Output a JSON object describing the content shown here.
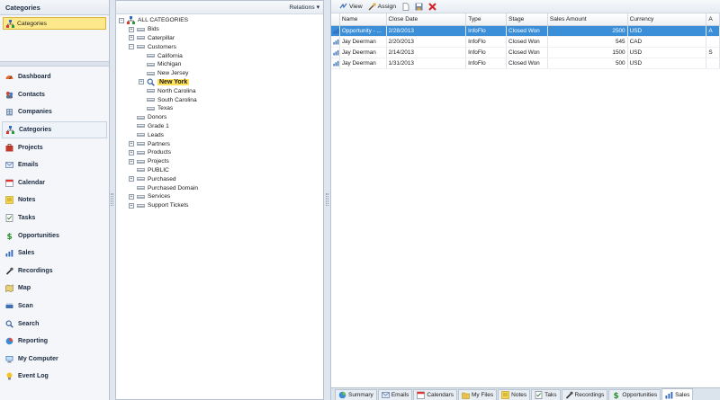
{
  "left": {
    "title": "Categories",
    "selected_category": "Categories"
  },
  "nav": [
    {
      "label": "Dashboard",
      "icon": "dashboard-icon"
    },
    {
      "label": "Contacts",
      "icon": "contacts-icon"
    },
    {
      "label": "Companies",
      "icon": "companies-icon"
    },
    {
      "label": "Categories",
      "icon": "categories-icon"
    },
    {
      "label": "Projects",
      "icon": "projects-icon"
    },
    {
      "label": "Emails",
      "icon": "emails-icon"
    },
    {
      "label": "Calendar",
      "icon": "calendar-icon"
    },
    {
      "label": "Notes",
      "icon": "notes-icon"
    },
    {
      "label": "Tasks",
      "icon": "tasks-icon"
    },
    {
      "label": "Opportunities",
      "icon": "opportunities-icon"
    },
    {
      "label": "Sales",
      "icon": "sales-icon"
    },
    {
      "label": "Recordings",
      "icon": "recordings-icon"
    },
    {
      "label": "Map",
      "icon": "map-icon"
    },
    {
      "label": "Scan",
      "icon": "scan-icon"
    },
    {
      "label": "Search",
      "icon": "search-icon"
    },
    {
      "label": "Reporting",
      "icon": "reporting-icon"
    },
    {
      "label": "My Computer",
      "icon": "my-computer-icon"
    },
    {
      "label": "Event Log",
      "icon": "event-log-icon"
    }
  ],
  "tree_panel": {
    "relations_label": "Relations ▾",
    "nodes": [
      {
        "label": "ALL CATEGORIES",
        "level": 0,
        "expander": "−",
        "root": true
      },
      {
        "label": "Bids",
        "level": 1,
        "expander": "+"
      },
      {
        "label": "Caterpillar",
        "level": 1,
        "expander": "+"
      },
      {
        "label": "Customers",
        "level": 1,
        "expander": "−"
      },
      {
        "label": "California",
        "level": 2,
        "expander": ""
      },
      {
        "label": "Michigan",
        "level": 2,
        "expander": ""
      },
      {
        "label": "New Jersey",
        "level": 2,
        "expander": ""
      },
      {
        "label": "New York",
        "level": 2,
        "expander": "+",
        "selected": true
      },
      {
        "label": "North Carolina",
        "level": 2,
        "expander": ""
      },
      {
        "label": "South Carolina",
        "level": 2,
        "expander": ""
      },
      {
        "label": "Texas",
        "level": 2,
        "expander": ""
      },
      {
        "label": "Donors",
        "level": 1,
        "expander": ""
      },
      {
        "label": "Grade 1",
        "level": 1,
        "expander": ""
      },
      {
        "label": "Leads",
        "level": 1,
        "expander": ""
      },
      {
        "label": "Partners",
        "level": 1,
        "expander": "+"
      },
      {
        "label": "Products",
        "level": 1,
        "expander": "+"
      },
      {
        "label": "Projects",
        "level": 1,
        "expander": "+"
      },
      {
        "label": "PUBLIC",
        "level": 1,
        "expander": ""
      },
      {
        "label": "Purchased",
        "level": 1,
        "expander": "+"
      },
      {
        "label": "Purchased Domain",
        "level": 1,
        "expander": ""
      },
      {
        "label": "Services",
        "level": 1,
        "expander": "+"
      },
      {
        "label": "Support Tickets",
        "level": 1,
        "expander": "+"
      }
    ]
  },
  "toolbar": {
    "view_label": "View",
    "assign_label": "Assign"
  },
  "grid": {
    "columns": [
      {
        "label": "",
        "w": 10
      },
      {
        "label": "Name",
        "w": 53
      },
      {
        "label": "Close Date",
        "w": 91
      },
      {
        "label": "Type",
        "w": 46
      },
      {
        "label": "Stage",
        "w": 47
      },
      {
        "label": "Sales Amount",
        "w": 91
      },
      {
        "label": "Currency",
        "w": 90
      },
      {
        "label": "A",
        "w": 15
      }
    ],
    "rows": [
      {
        "name": "Opportunity - ...",
        "close_date": "2/28/2013",
        "type": "InfoFlo",
        "stage": "Closed Won",
        "amount": "2500",
        "currency": "USD",
        "extra": "A",
        "selected": true
      },
      {
        "name": "Jay Deerman",
        "close_date": "2/20/2013",
        "type": "InfoFlo",
        "stage": "Closed Won",
        "amount": "545",
        "currency": "CAD",
        "extra": ""
      },
      {
        "name": "Jay Deerman",
        "close_date": "2/14/2013",
        "type": "InfoFlo",
        "stage": "Closed Won",
        "amount": "1500",
        "currency": "USD",
        "extra": "S"
      },
      {
        "name": "Jay Deerman",
        "close_date": "1/31/2013",
        "type": "InfoFlo",
        "stage": "Closed Won",
        "amount": "500",
        "currency": "USD",
        "extra": ""
      }
    ]
  },
  "tabs": [
    {
      "label": "Summary",
      "icon": "summary-icon"
    },
    {
      "label": "Emails",
      "icon": "emails-icon"
    },
    {
      "label": "Calendars",
      "icon": "calendars-icon"
    },
    {
      "label": "My Files",
      "icon": "my-files-icon"
    },
    {
      "label": "Notes",
      "icon": "notes-icon"
    },
    {
      "label": "Taks",
      "icon": "tasks-icon"
    },
    {
      "label": "Recordings",
      "icon": "recordings-icon"
    },
    {
      "label": "Opportunities",
      "icon": "opportunities-icon"
    },
    {
      "label": "Sales",
      "icon": "sales-icon",
      "active": true
    }
  ]
}
